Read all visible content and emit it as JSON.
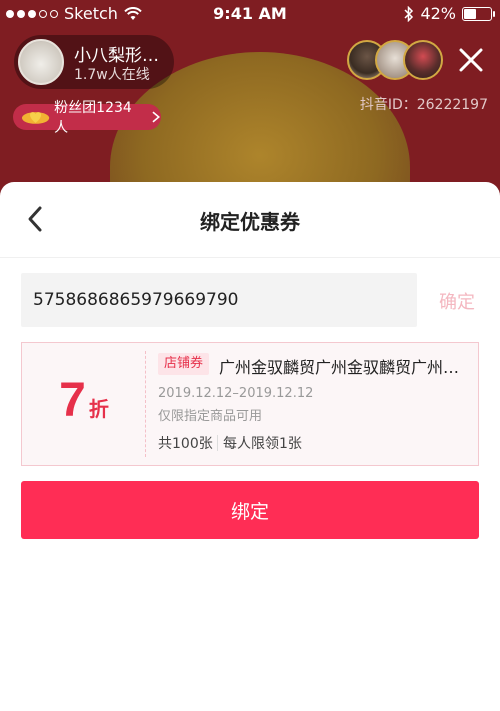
{
  "status_bar": {
    "carrier": "Sketch",
    "time": "9:41 AM",
    "battery": "42%",
    "battery_level": 0.42
  },
  "live": {
    "host_name": "小八梨形…",
    "online_count": "1.7w人在线",
    "douyin_id": "抖音ID：26222197",
    "fan_badge": "粉丝团1234人",
    "viewer_icons": [
      "viewer-avatar",
      "viewer-avatar",
      "viewer-avatar"
    ]
  },
  "sheet": {
    "title": "绑定优惠券",
    "code_value": "5758686865979669790",
    "confirm_label": "确定",
    "coupon": {
      "discount_value": "7",
      "discount_unit": "折",
      "tag": "店铺券",
      "shop_name": "广州金驭麟贸广州金驭麟贸广州…",
      "date_range": "2019.12.12–2019.12.12",
      "limit_text": "仅限指定商品可用",
      "total_text": "共100张",
      "per_user_text": "每人限领1张"
    },
    "bind_button": "绑定"
  },
  "colors": {
    "accent": "#ff2d55",
    "coupon_red": "#e6304a",
    "confirm_disabled": "#f4b7c0"
  }
}
